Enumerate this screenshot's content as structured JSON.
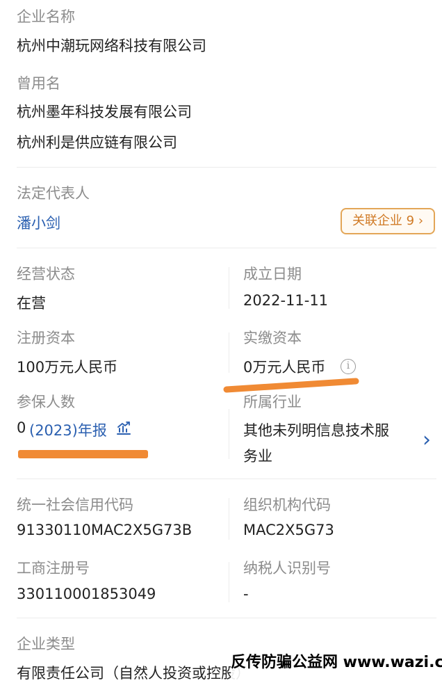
{
  "company": {
    "name_label": "企业名称",
    "name": "杭州中潮玩网络科技有限公司",
    "former_label": "曾用名",
    "former_names": [
      "杭州墨年科技发展有限公司",
      "杭州利是供应链有限公司"
    ]
  },
  "legal_rep": {
    "label": "法定代表人",
    "name": "潘小剑",
    "related_button": "关联企业 9",
    "chevron": "›"
  },
  "status": {
    "operating_label": "经营状态",
    "operating_value": "在营",
    "founded_label": "成立日期",
    "founded_value": "2022-11-11",
    "registered_capital_label": "注册资本",
    "registered_capital_value": "100万元人民币",
    "paid_capital_label": "实缴资本",
    "paid_capital_value": "0万元人民币",
    "info_icon_glyph": "i",
    "insured_label": "参保人数",
    "insured_count": "0",
    "insured_report": "(2023)年报",
    "industry_label": "所属行业",
    "industry_line1": "其他未列明信息技术服",
    "industry_line2": "务业",
    "industry_chevron": "›"
  },
  "codes": {
    "credit_code_label": "统一社会信用代码",
    "credit_code_value": "91330110MAC2X5G73B",
    "org_code_label": "组织机构代码",
    "org_code_value": "MAC2X5G73",
    "biz_reg_label": "工商注册号",
    "biz_reg_value": "330110001853049",
    "tax_id_label": "纳税人识别号",
    "tax_id_value": "-"
  },
  "enterprise_type": {
    "label": "企业类型",
    "value": "有限责任公司（自然人投资或控股）"
  },
  "watermark": "反传防骗公益网 www.wazi.cc",
  "colors": {
    "label": "#8c8c8c",
    "value": "#222222",
    "link": "#2a5fb0",
    "accent_orange": "#e3a657",
    "highlight_stroke": "#f08a34"
  }
}
